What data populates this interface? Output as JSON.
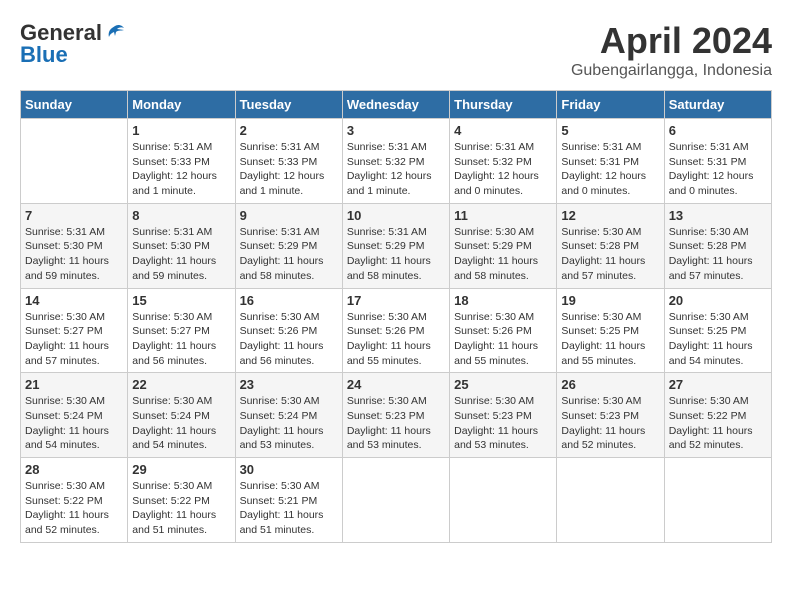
{
  "header": {
    "logo_general": "General",
    "logo_blue": "Blue",
    "month_title": "April 2024",
    "location": "Gubengairlangga, Indonesia"
  },
  "calendar": {
    "headers": [
      "Sunday",
      "Monday",
      "Tuesday",
      "Wednesday",
      "Thursday",
      "Friday",
      "Saturday"
    ],
    "weeks": [
      [
        {
          "day": "",
          "info": ""
        },
        {
          "day": "1",
          "info": "Sunrise: 5:31 AM\nSunset: 5:33 PM\nDaylight: 12 hours\nand 1 minute."
        },
        {
          "day": "2",
          "info": "Sunrise: 5:31 AM\nSunset: 5:33 PM\nDaylight: 12 hours\nand 1 minute."
        },
        {
          "day": "3",
          "info": "Sunrise: 5:31 AM\nSunset: 5:32 PM\nDaylight: 12 hours\nand 1 minute."
        },
        {
          "day": "4",
          "info": "Sunrise: 5:31 AM\nSunset: 5:32 PM\nDaylight: 12 hours\nand 0 minutes."
        },
        {
          "day": "5",
          "info": "Sunrise: 5:31 AM\nSunset: 5:31 PM\nDaylight: 12 hours\nand 0 minutes."
        },
        {
          "day": "6",
          "info": "Sunrise: 5:31 AM\nSunset: 5:31 PM\nDaylight: 12 hours\nand 0 minutes."
        }
      ],
      [
        {
          "day": "7",
          "info": "Sunrise: 5:31 AM\nSunset: 5:30 PM\nDaylight: 11 hours\nand 59 minutes."
        },
        {
          "day": "8",
          "info": "Sunrise: 5:31 AM\nSunset: 5:30 PM\nDaylight: 11 hours\nand 59 minutes."
        },
        {
          "day": "9",
          "info": "Sunrise: 5:31 AM\nSunset: 5:29 PM\nDaylight: 11 hours\nand 58 minutes."
        },
        {
          "day": "10",
          "info": "Sunrise: 5:31 AM\nSunset: 5:29 PM\nDaylight: 11 hours\nand 58 minutes."
        },
        {
          "day": "11",
          "info": "Sunrise: 5:30 AM\nSunset: 5:29 PM\nDaylight: 11 hours\nand 58 minutes."
        },
        {
          "day": "12",
          "info": "Sunrise: 5:30 AM\nSunset: 5:28 PM\nDaylight: 11 hours\nand 57 minutes."
        },
        {
          "day": "13",
          "info": "Sunrise: 5:30 AM\nSunset: 5:28 PM\nDaylight: 11 hours\nand 57 minutes."
        }
      ],
      [
        {
          "day": "14",
          "info": "Sunrise: 5:30 AM\nSunset: 5:27 PM\nDaylight: 11 hours\nand 57 minutes."
        },
        {
          "day": "15",
          "info": "Sunrise: 5:30 AM\nSunset: 5:27 PM\nDaylight: 11 hours\nand 56 minutes."
        },
        {
          "day": "16",
          "info": "Sunrise: 5:30 AM\nSunset: 5:26 PM\nDaylight: 11 hours\nand 56 minutes."
        },
        {
          "day": "17",
          "info": "Sunrise: 5:30 AM\nSunset: 5:26 PM\nDaylight: 11 hours\nand 55 minutes."
        },
        {
          "day": "18",
          "info": "Sunrise: 5:30 AM\nSunset: 5:26 PM\nDaylight: 11 hours\nand 55 minutes."
        },
        {
          "day": "19",
          "info": "Sunrise: 5:30 AM\nSunset: 5:25 PM\nDaylight: 11 hours\nand 55 minutes."
        },
        {
          "day": "20",
          "info": "Sunrise: 5:30 AM\nSunset: 5:25 PM\nDaylight: 11 hours\nand 54 minutes."
        }
      ],
      [
        {
          "day": "21",
          "info": "Sunrise: 5:30 AM\nSunset: 5:24 PM\nDaylight: 11 hours\nand 54 minutes."
        },
        {
          "day": "22",
          "info": "Sunrise: 5:30 AM\nSunset: 5:24 PM\nDaylight: 11 hours\nand 54 minutes."
        },
        {
          "day": "23",
          "info": "Sunrise: 5:30 AM\nSunset: 5:24 PM\nDaylight: 11 hours\nand 53 minutes."
        },
        {
          "day": "24",
          "info": "Sunrise: 5:30 AM\nSunset: 5:23 PM\nDaylight: 11 hours\nand 53 minutes."
        },
        {
          "day": "25",
          "info": "Sunrise: 5:30 AM\nSunset: 5:23 PM\nDaylight: 11 hours\nand 53 minutes."
        },
        {
          "day": "26",
          "info": "Sunrise: 5:30 AM\nSunset: 5:23 PM\nDaylight: 11 hours\nand 52 minutes."
        },
        {
          "day": "27",
          "info": "Sunrise: 5:30 AM\nSunset: 5:22 PM\nDaylight: 11 hours\nand 52 minutes."
        }
      ],
      [
        {
          "day": "28",
          "info": "Sunrise: 5:30 AM\nSunset: 5:22 PM\nDaylight: 11 hours\nand 52 minutes."
        },
        {
          "day": "29",
          "info": "Sunrise: 5:30 AM\nSunset: 5:22 PM\nDaylight: 11 hours\nand 51 minutes."
        },
        {
          "day": "30",
          "info": "Sunrise: 5:30 AM\nSunset: 5:21 PM\nDaylight: 11 hours\nand 51 minutes."
        },
        {
          "day": "",
          "info": ""
        },
        {
          "day": "",
          "info": ""
        },
        {
          "day": "",
          "info": ""
        },
        {
          "day": "",
          "info": ""
        }
      ]
    ]
  }
}
